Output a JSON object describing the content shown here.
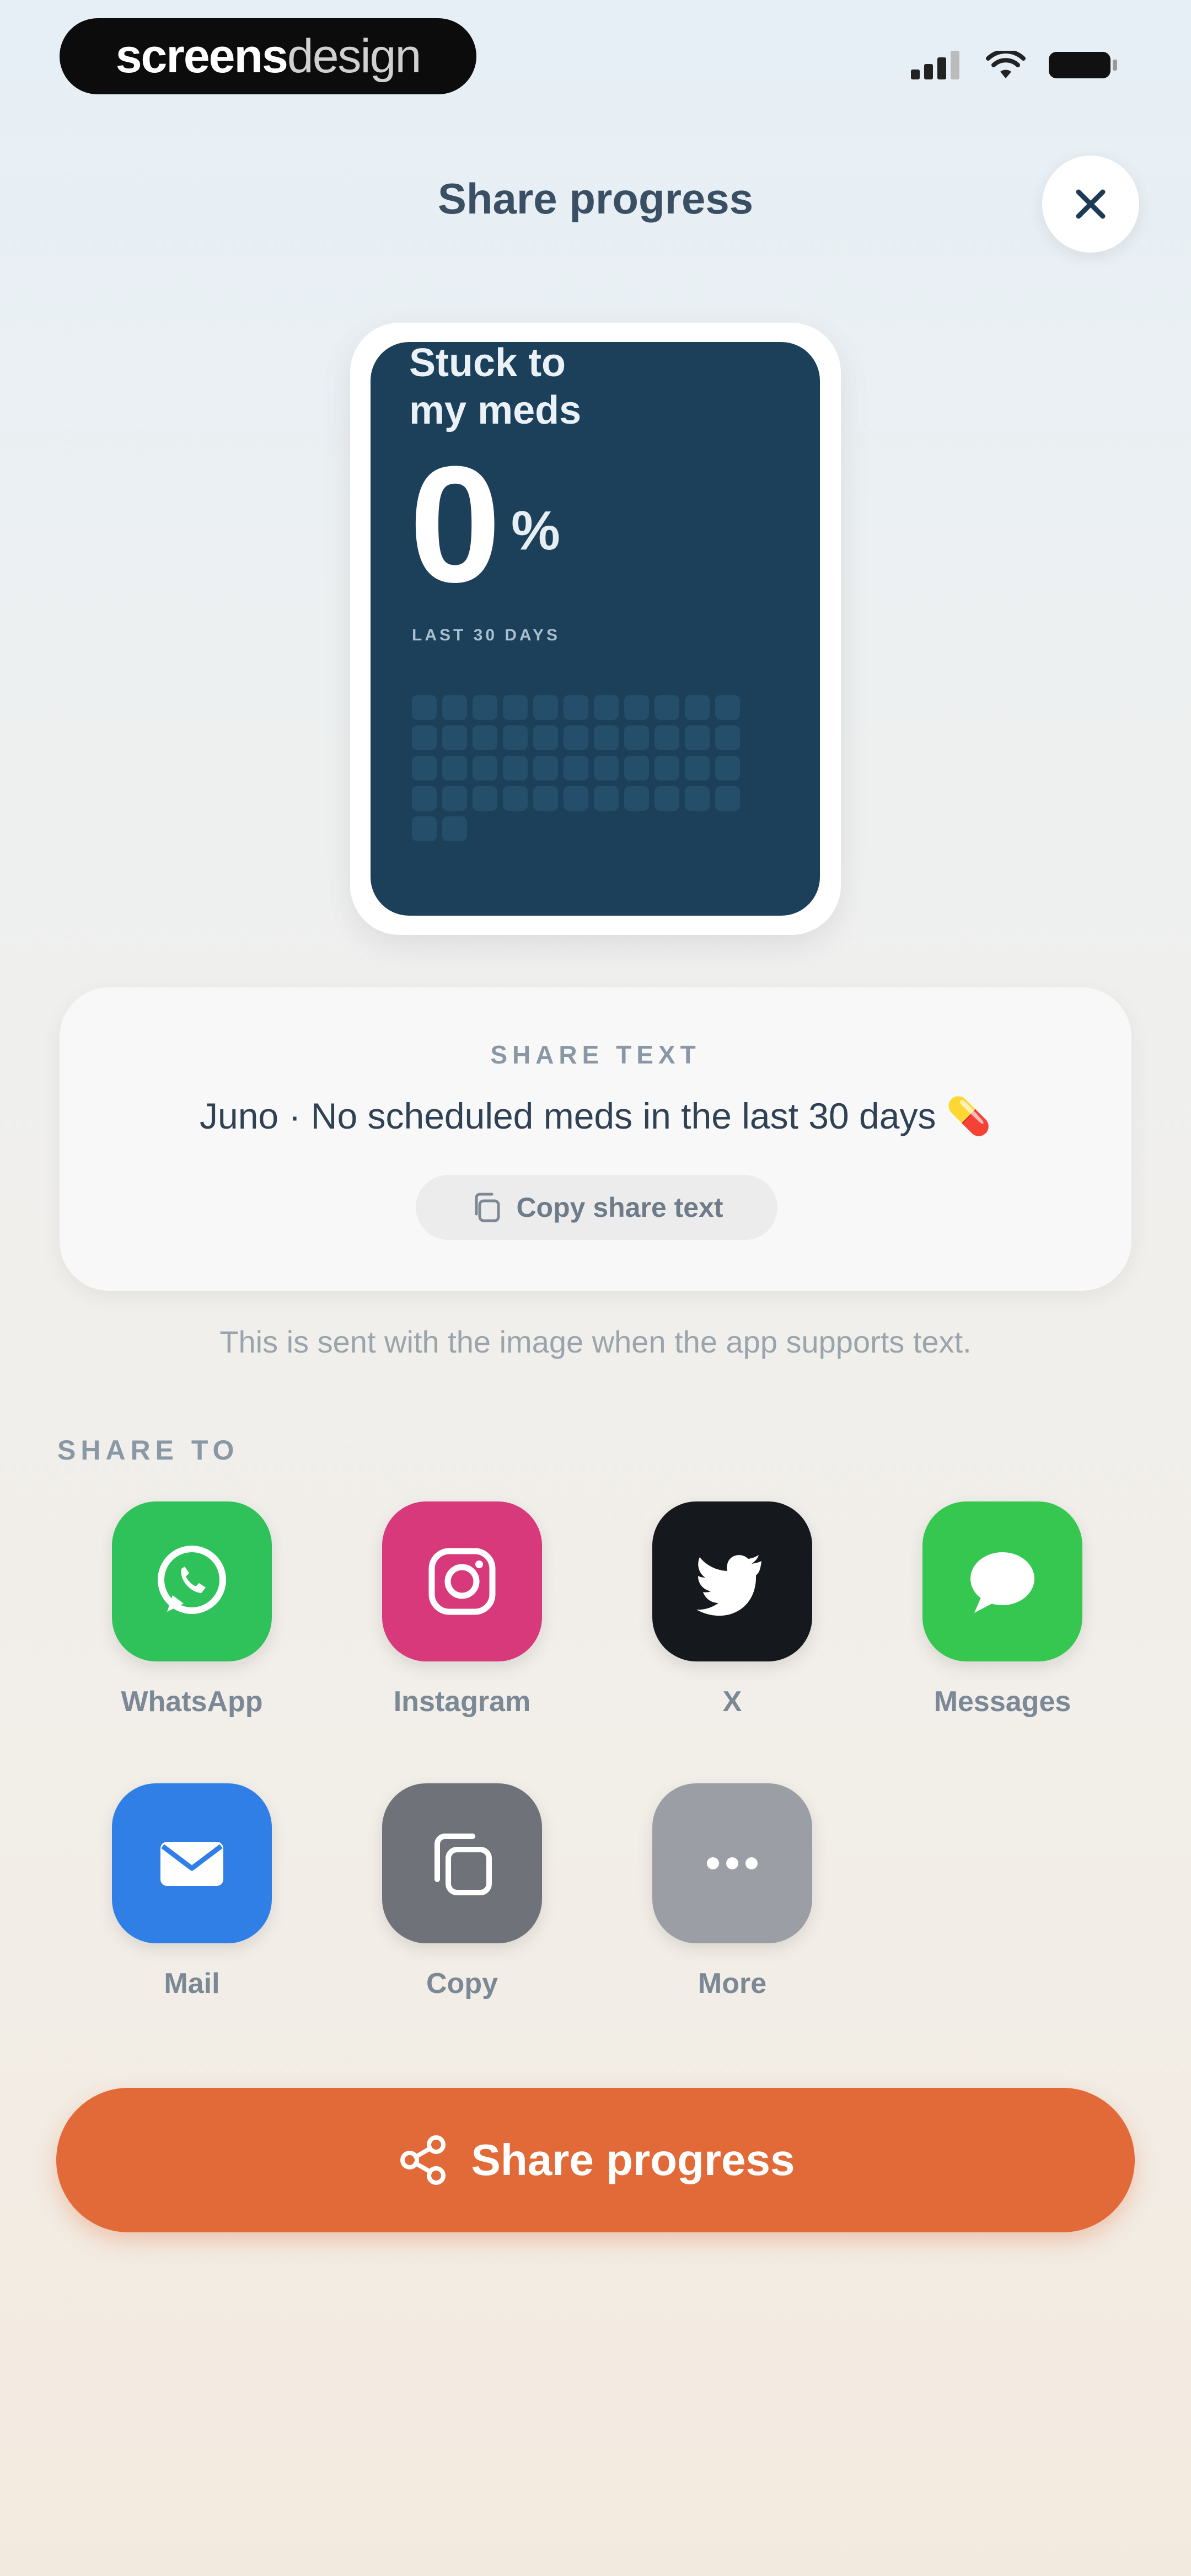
{
  "status_bar": {
    "brand_part1": "screens",
    "brand_part2": "design"
  },
  "header": {
    "title": "Share progress"
  },
  "preview_card": {
    "heading": "Stuck to\nmy meds",
    "percent": "0",
    "percent_sign": "%",
    "period": "LAST 30 DAYS"
  },
  "share_text": {
    "label": "SHARE TEXT",
    "message": "Juno · No scheduled meds in the last 30 days 💊",
    "copy_button": "Copy share text",
    "hint": "This is sent with the image when the app supports text."
  },
  "share_to": {
    "label": "SHARE TO",
    "apps": [
      {
        "label": "WhatsApp",
        "icon": "whatsapp-icon",
        "color": "#2fc25b"
      },
      {
        "label": "Instagram",
        "icon": "instagram-icon",
        "color": "#d8397a"
      },
      {
        "label": "X",
        "icon": "x-icon",
        "color": "#15181c"
      },
      {
        "label": "Messages",
        "icon": "messages-icon",
        "color": "#35c74f"
      },
      {
        "label": "Mail",
        "icon": "mail-icon",
        "color": "#2f7fe6"
      },
      {
        "label": "Copy",
        "icon": "copy-icon",
        "color": "#6f7278"
      },
      {
        "label": "More",
        "icon": "more-icon",
        "color": "#9b9ea5"
      }
    ]
  },
  "primary_action": {
    "label": "Share progress",
    "color": "#e26a38"
  }
}
